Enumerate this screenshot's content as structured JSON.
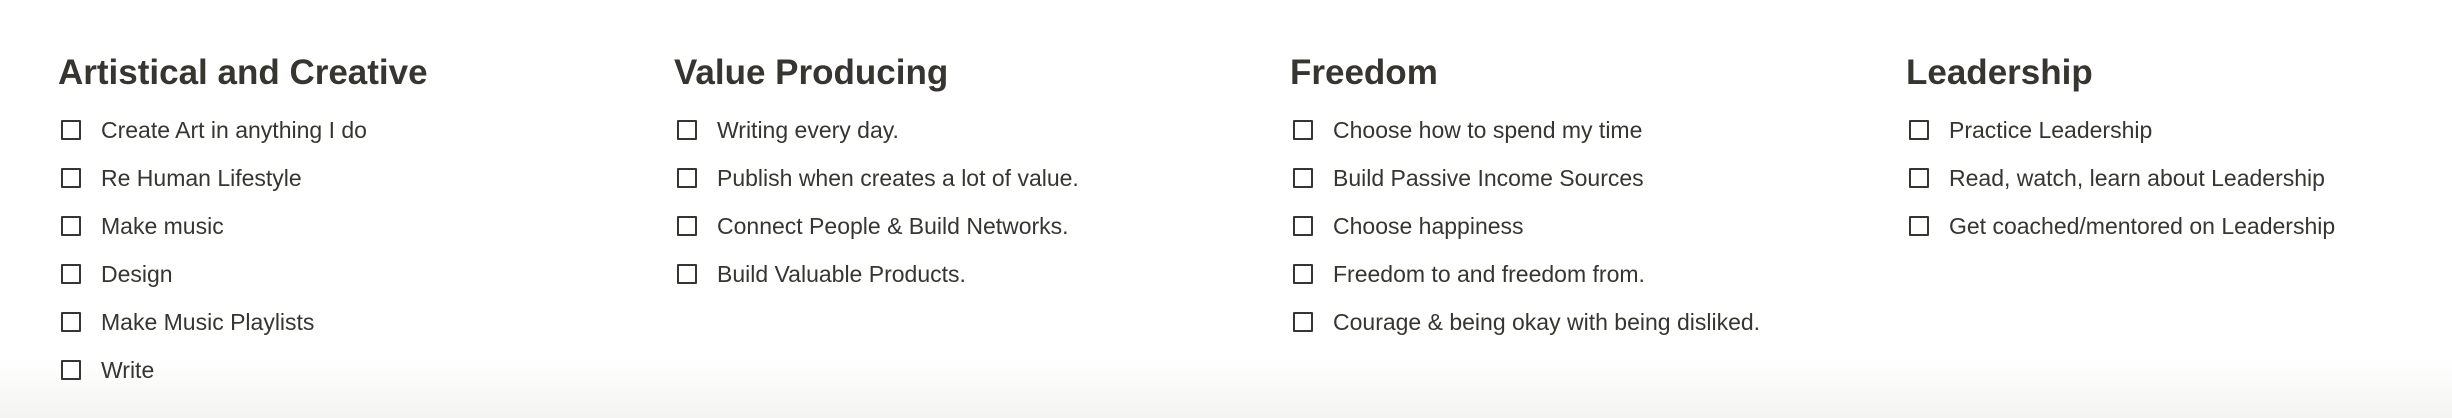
{
  "columns": [
    {
      "heading": "Artistical and Creative",
      "items": [
        {
          "label": "Create Art in anything I do",
          "checked": false
        },
        {
          "label": "Re Human Lifestyle",
          "checked": false
        },
        {
          "label": "Make music",
          "checked": false
        },
        {
          "label": "Design",
          "checked": false
        },
        {
          "label": "Make Music Playlists",
          "checked": false
        },
        {
          "label": "Write",
          "checked": false
        }
      ]
    },
    {
      "heading": "Value Producing",
      "items": [
        {
          "label": "Writing every day.",
          "checked": false
        },
        {
          "label": "Publish when creates a lot of value.",
          "checked": false
        },
        {
          "label": "Connect People & Build Networks.",
          "checked": false
        },
        {
          "label": "Build Valuable Products.",
          "checked": false
        }
      ]
    },
    {
      "heading": "Freedom",
      "items": [
        {
          "label": "Choose how to spend my time",
          "checked": false
        },
        {
          "label": "Build Passive Income Sources",
          "checked": false
        },
        {
          "label": "Choose happiness",
          "checked": false
        },
        {
          "label": "Freedom to and freedom from.",
          "checked": false
        },
        {
          "label": "Courage & being okay with being disliked.",
          "checked": false
        }
      ]
    },
    {
      "heading": "Leadership",
      "items": [
        {
          "label": "Practice Leadership",
          "checked": false
        },
        {
          "label": "Read, watch, learn about Leadership",
          "checked": false
        },
        {
          "label": "Get coached/mentored on Leadership",
          "checked": false
        }
      ]
    }
  ]
}
